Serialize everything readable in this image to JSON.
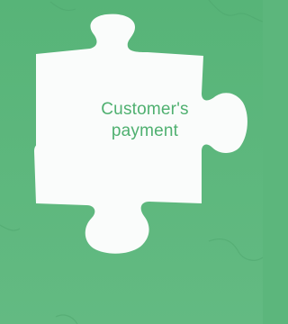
{
  "puzzle": {
    "label_line1": "Customer's",
    "label_line2": "payment"
  },
  "colors": {
    "background": "#5cb67c",
    "piece": "#fafcfb",
    "text": "#4fb070"
  }
}
